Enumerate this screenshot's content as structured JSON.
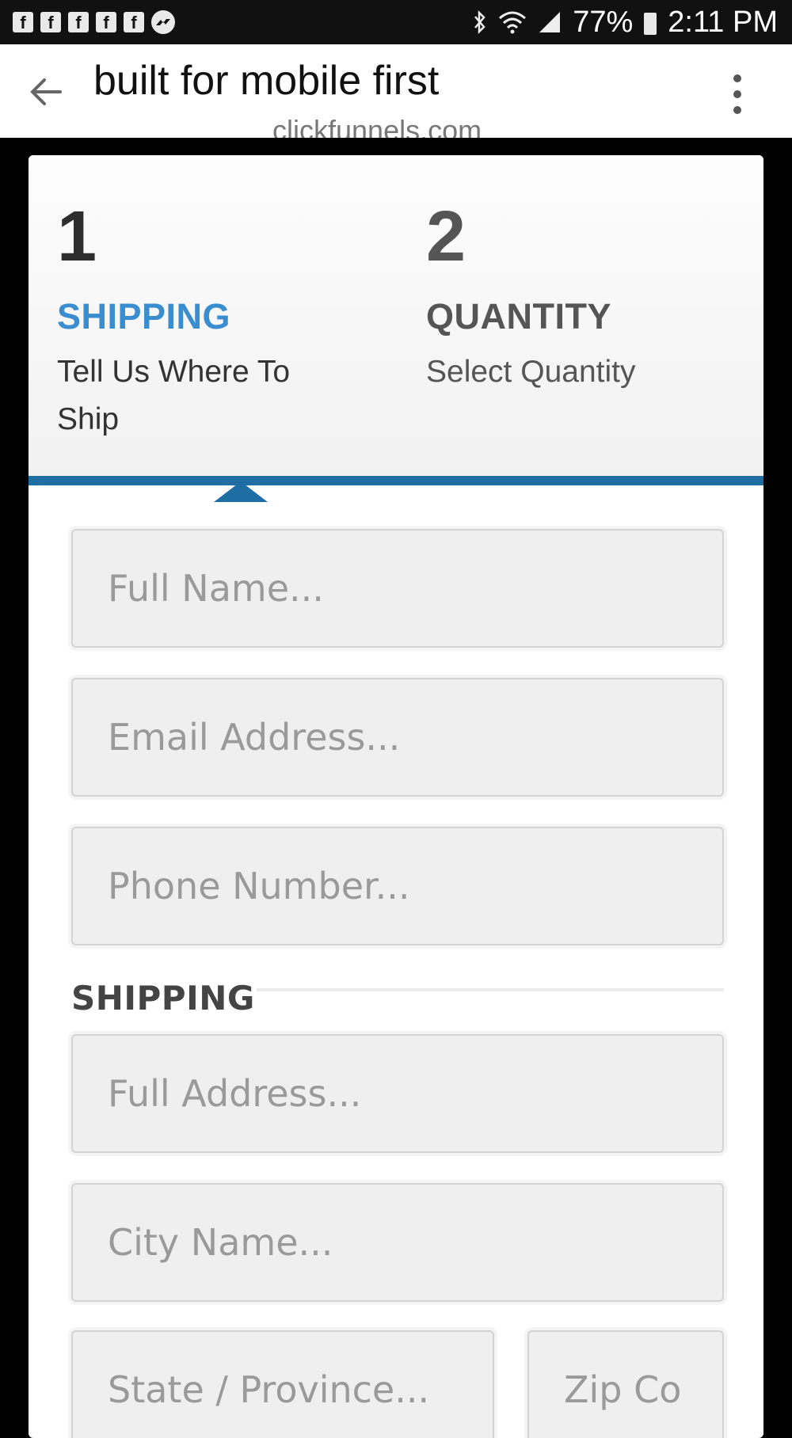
{
  "status_bar": {
    "notifications": [
      "facebook-icon",
      "facebook-icon",
      "facebook-icon",
      "facebook-icon",
      "facebook-icon",
      "messenger-icon"
    ],
    "battery": "77%",
    "time": "2:11 PM"
  },
  "browser": {
    "page_title": "built for mobile first",
    "domain": "clickfunnels.com"
  },
  "steps": [
    {
      "number": "1",
      "label": "SHIPPING",
      "description": "Tell Us Where To Ship"
    },
    {
      "number": "2",
      "label": "QUANTITY",
      "description": "Select Quantity"
    }
  ],
  "form": {
    "full_name_placeholder": "Full Name...",
    "email_placeholder": "Email Address...",
    "phone_placeholder": "Phone Number...",
    "shipping_section_title": "SHIPPING",
    "address_placeholder": "Full Address...",
    "city_placeholder": "City Name...",
    "state_placeholder": "State / Province...",
    "zip_placeholder": "Zip Co"
  },
  "colors": {
    "accent": "#1f6ea3",
    "active_step": "#3a8ed0"
  }
}
